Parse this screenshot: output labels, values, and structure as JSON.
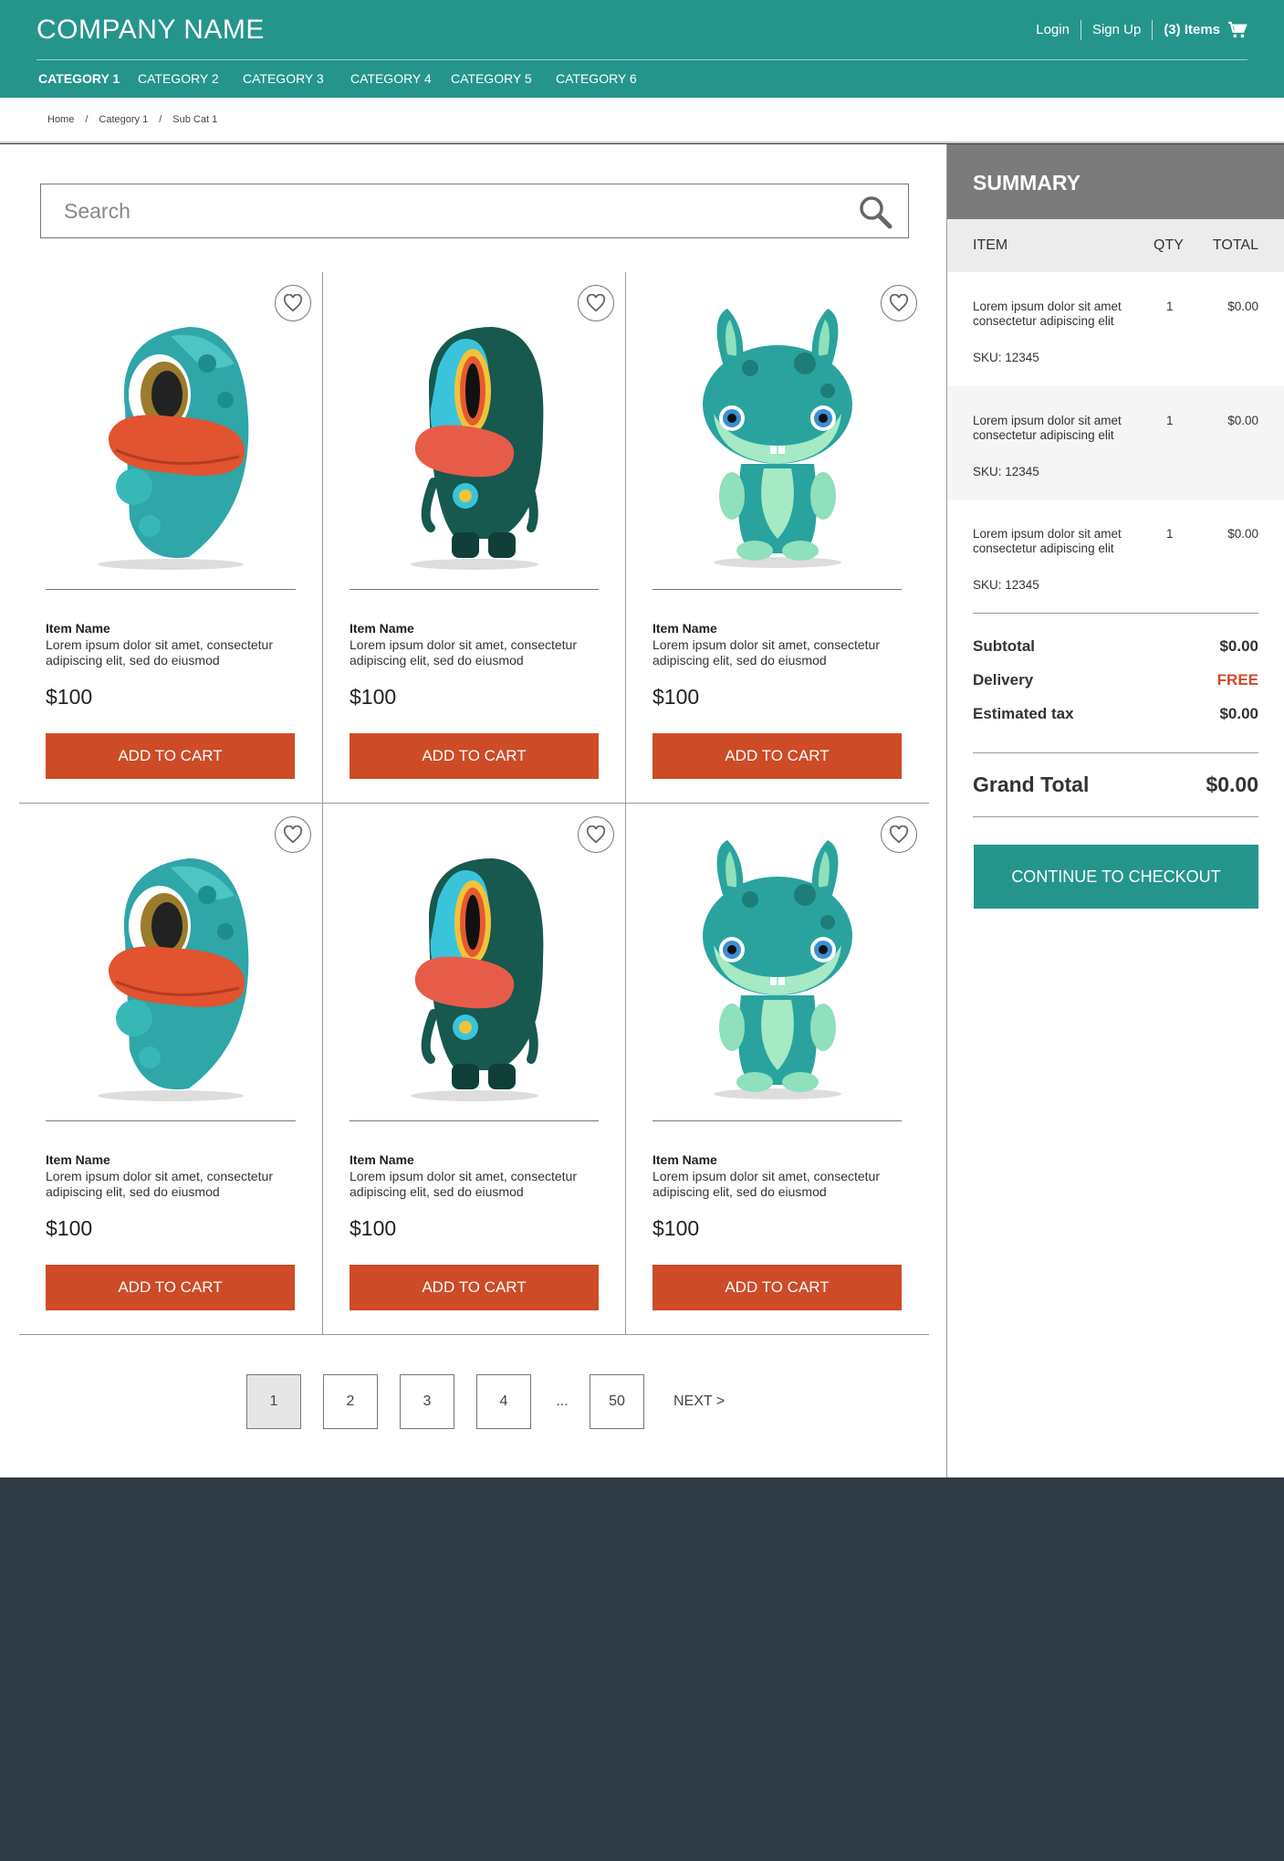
{
  "header": {
    "brand": "COMPANY NAME",
    "login": "Login",
    "signup": "Sign Up",
    "items": "(3) Items",
    "categories": [
      "CATEGORY 1",
      "CATEGORY 2",
      "CATEGORY 3",
      "CATEGORY 4",
      "CATEGORY 5",
      "CATEGORY 6"
    ],
    "active_category": "CATEGORY 1",
    "cart_icon": "cart-icon"
  },
  "breadcrumb": [
    "Home",
    "/",
    "Category 1",
    "/",
    "Sub Cat 1"
  ],
  "search": {
    "placeholder": "Search",
    "icon": "search-icon"
  },
  "products": [
    {
      "name": "Item Name",
      "desc": "Lorem ipsum dolor sit amet, consectetur adipiscing elit, sed do eiusmod",
      "price": "$100",
      "button": "ADD TO CART",
      "figure": "duck-toy"
    },
    {
      "name": "Item Name",
      "desc": "Lorem ipsum dolor sit amet, consectetur adipiscing elit, sed do eiusmod",
      "price": "$100",
      "button": "ADD TO CART",
      "figure": "frog-toy"
    },
    {
      "name": "Item Name",
      "desc": "Lorem ipsum dolor sit amet, consectetur adipiscing elit, sed do eiusmod",
      "price": "$100",
      "button": "ADD TO CART",
      "figure": "bunny-toy"
    },
    {
      "name": "Item Name",
      "desc": "Lorem ipsum dolor sit amet, consectetur adipiscing elit, sed do eiusmod",
      "price": "$100",
      "button": "ADD TO CART",
      "figure": "duck-toy"
    },
    {
      "name": "Item Name",
      "desc": "Lorem ipsum dolor sit amet, consectetur adipiscing elit, sed do eiusmod",
      "price": "$100",
      "button": "ADD TO CART",
      "figure": "frog-toy"
    },
    {
      "name": "Item Name",
      "desc": "Lorem ipsum dolor sit amet, consectetur adipiscing elit, sed do eiusmod",
      "price": "$100",
      "button": "ADD TO CART",
      "figure": "bunny-toy"
    }
  ],
  "pagination": {
    "pages": [
      "1",
      "2",
      "3",
      "4"
    ],
    "ellipsis": "...",
    "last": "50",
    "next": "NEXT >",
    "current": "1"
  },
  "summary": {
    "title": "SUMMARY",
    "col_item": "ITEM",
    "col_qty": "QTY",
    "col_total": "TOTAL",
    "items": [
      {
        "desc": "Lorem ipsum dolor sit amet consectetur adipiscing elit",
        "qty": "1",
        "total": "$0.00",
        "sku": "SKU: 12345"
      },
      {
        "desc": "Lorem ipsum dolor sit amet consectetur adipiscing elit",
        "qty": "1",
        "total": "$0.00",
        "sku": "SKU: 12345"
      },
      {
        "desc": "Lorem ipsum dolor sit amet consectetur adipiscing elit",
        "qty": "1",
        "total": "$0.00",
        "sku": "SKU: 12345"
      }
    ],
    "subtotal_label": "Subtotal",
    "subtotal": "$0.00",
    "delivery_label": "Delivery",
    "delivery": "FREE",
    "tax_label": "Estimated tax",
    "tax": "$0.00",
    "grand_label": "Grand Total",
    "grand": "$0.00",
    "checkout": "CONTINUE TO CHECKOUT"
  },
  "colors": {
    "brand": "#25958c",
    "accent": "#cd4b26",
    "footer": "#2e3b45"
  }
}
